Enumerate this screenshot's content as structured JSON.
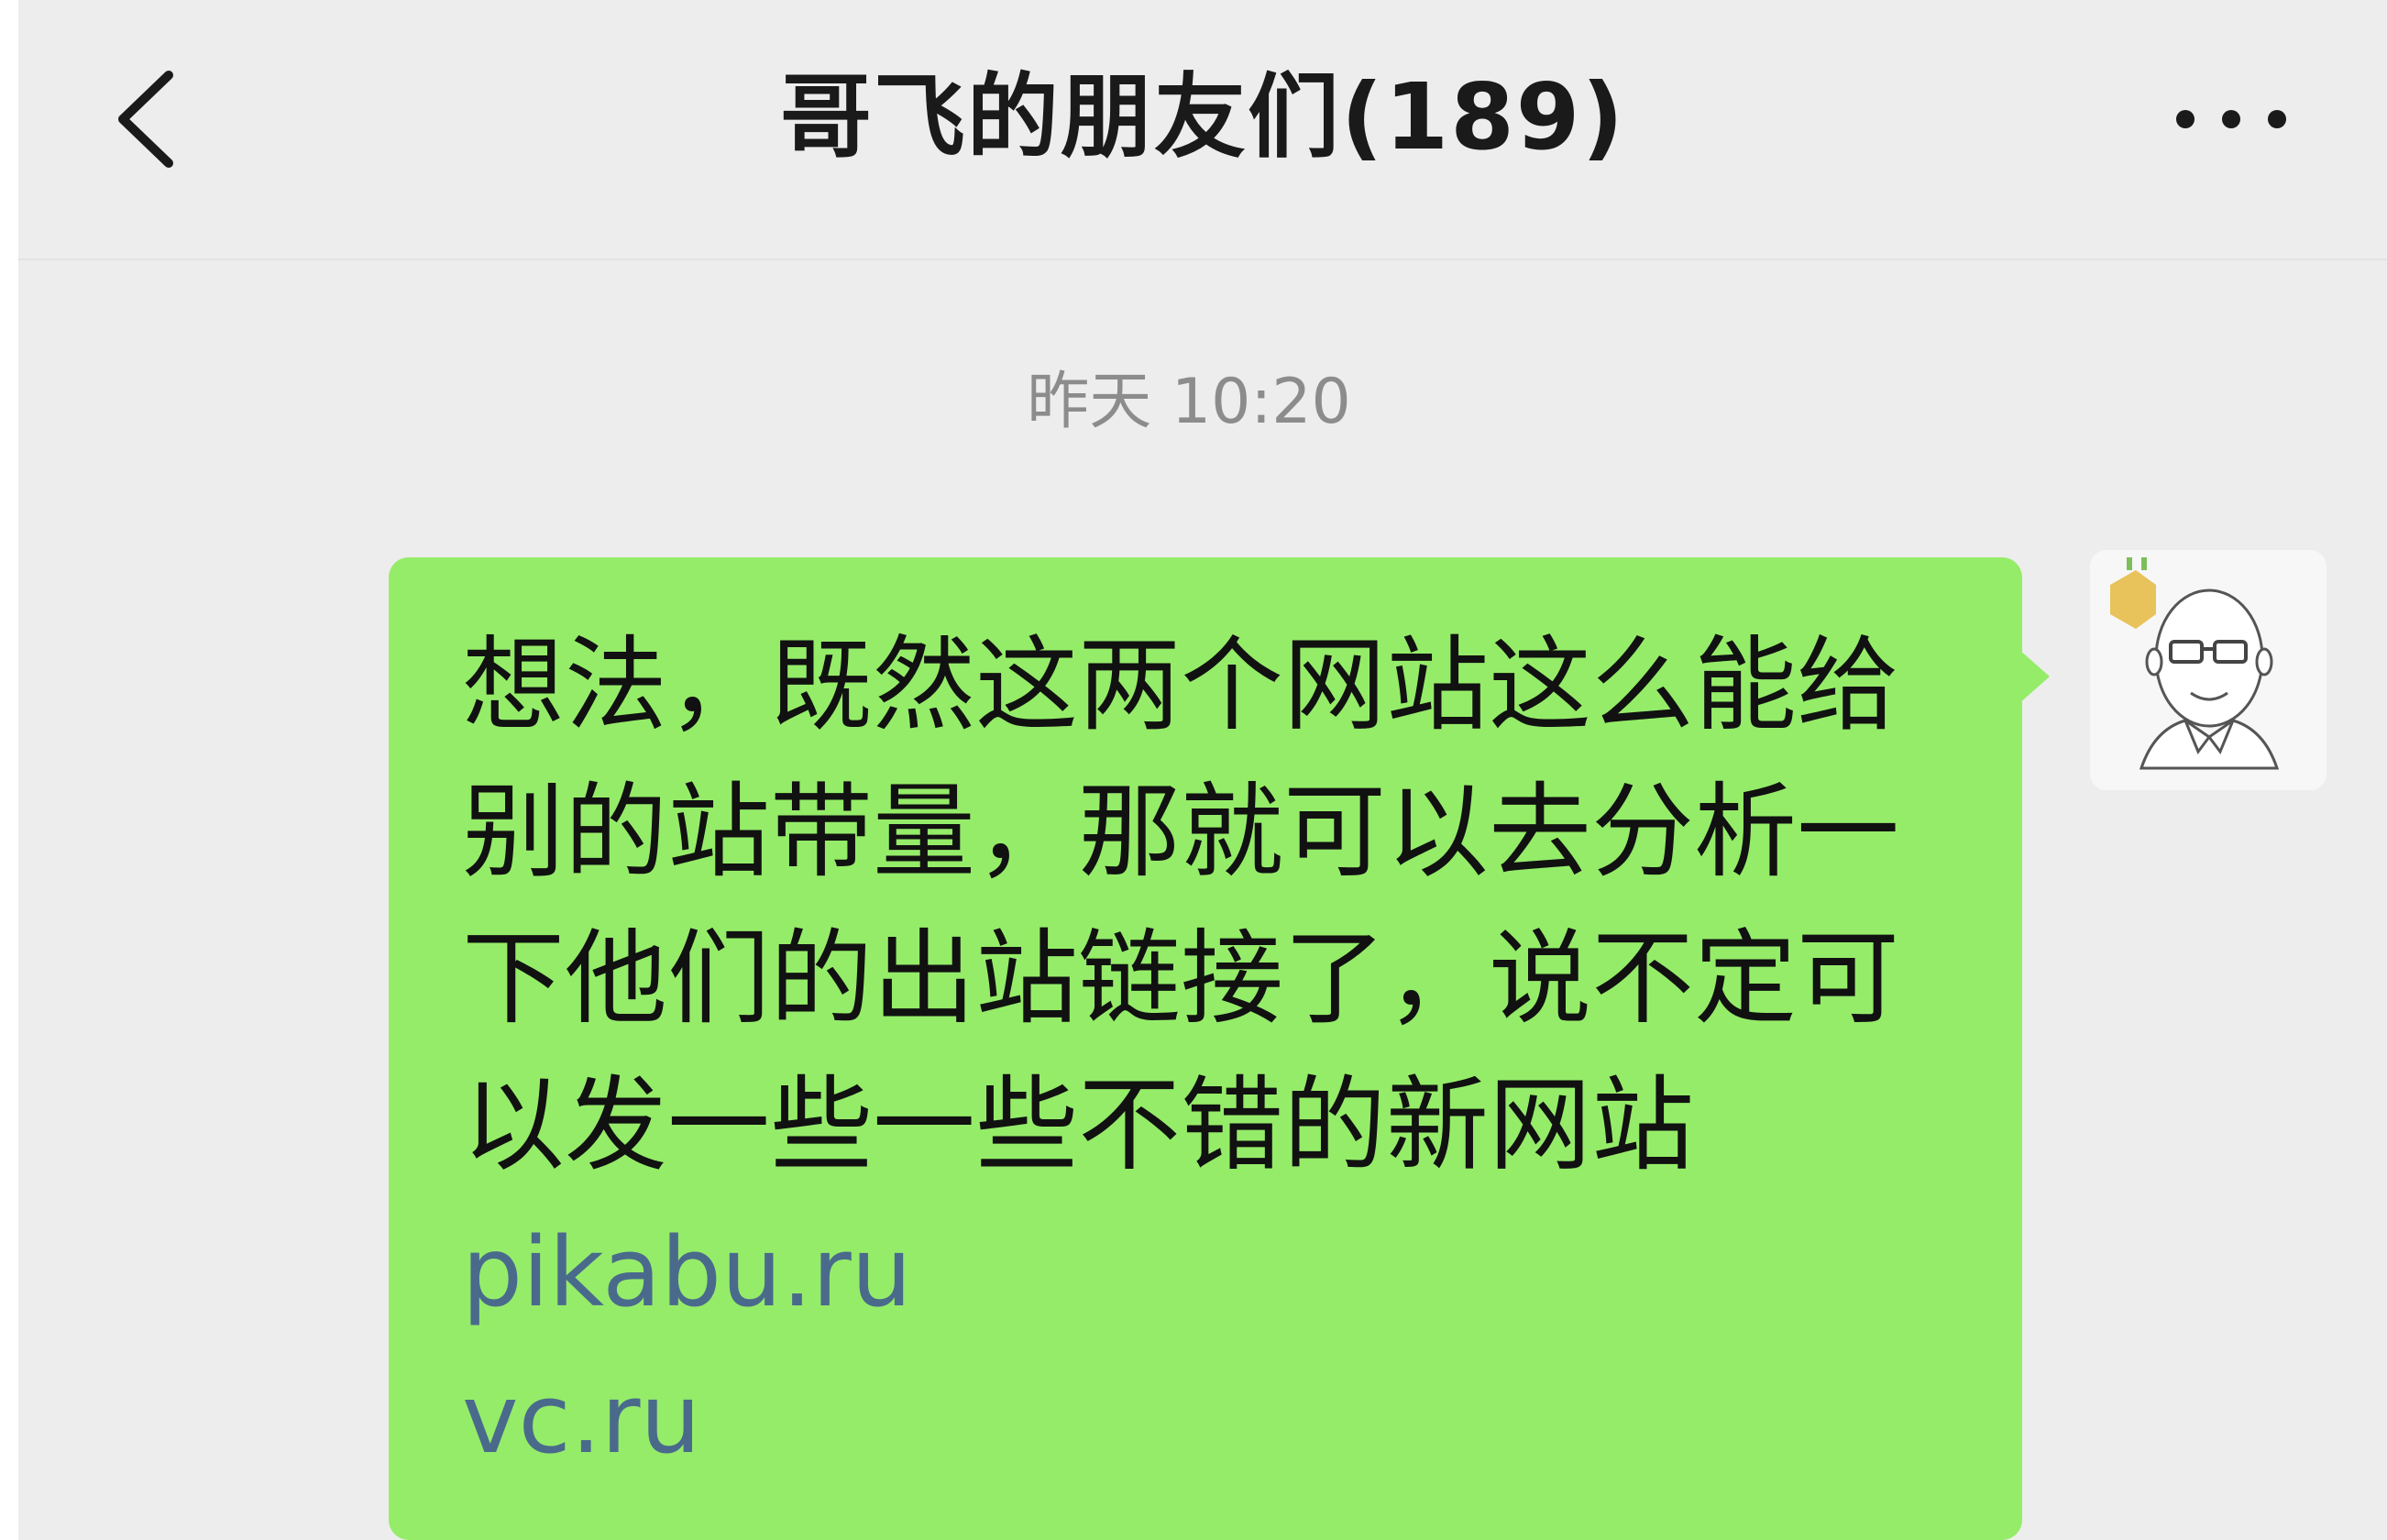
{
  "header": {
    "title": "哥飞的朋友们(189)",
    "back_icon": "chevron-left-icon",
    "more_icon": "more-dots-icon"
  },
  "chat": {
    "timestamp": "昨天 10:20",
    "message": {
      "text": "想法，既然这两个网站这么能给别的站带量，那就可以去分析一下他们的出站链接了，说不定可以发一些一些不错的新网站",
      "links": [
        "pikabu.ru",
        "vc.ru"
      ],
      "sender_avatar_icon": "cartoon-bald-man-avatar-icon"
    }
  },
  "colors": {
    "background": "#ededed",
    "bubble": "#95ec69",
    "link": "#4a6a8c",
    "timestamp": "#8c8c8c"
  }
}
